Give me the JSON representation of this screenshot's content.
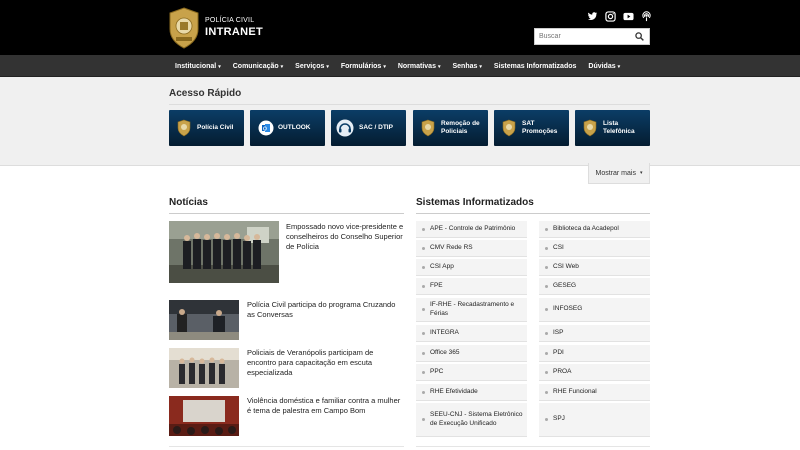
{
  "header": {
    "brand_small": "POLÍCIA CIVIL",
    "brand_big": "INTRANET",
    "search_placeholder": "Buscar",
    "social": [
      "twitter-icon",
      "instagram-icon",
      "youtube-icon",
      "podcast-icon"
    ]
  },
  "nav": {
    "items": [
      {
        "label": "Institucional",
        "dropdown": true
      },
      {
        "label": "Comunicação",
        "dropdown": true
      },
      {
        "label": "Serviços",
        "dropdown": true
      },
      {
        "label": "Formulários",
        "dropdown": true
      },
      {
        "label": "Normativas",
        "dropdown": true
      },
      {
        "label": "Senhas",
        "dropdown": true
      },
      {
        "label": "Sistemas Informatizados",
        "dropdown": false
      },
      {
        "label": "Dúvidas",
        "dropdown": true
      }
    ]
  },
  "quick_access": {
    "title": "Acesso Rápido",
    "buttons": [
      {
        "label": "Polícia Civil",
        "icon": "badge-icon"
      },
      {
        "label": "OUTLOOK",
        "icon": "outlook-icon"
      },
      {
        "label": "SAC / DTIP",
        "icon": "headset-icon"
      },
      {
        "label": "Remoção de Policiais",
        "icon": "badge-icon"
      },
      {
        "label": "SAT Promoções",
        "icon": "badge-icon"
      },
      {
        "label": "Lista Telefônica",
        "icon": "badge-icon"
      }
    ],
    "more_label": "Mostrar mais"
  },
  "news": {
    "title": "Notícias",
    "items": [
      {
        "text": "Empossado novo vice-presidente e conselheiros do Conselho Superior de Polícia"
      },
      {
        "text": "Polícia Civil participa do programa Cruzando as Conversas"
      },
      {
        "text": "Policiais de Veranópolis participam de encontro para capacitação em escuta especializada"
      },
      {
        "text": "Violência doméstica e familiar contra a mulher é tema de palestra em Campo Bom"
      }
    ]
  },
  "systems": {
    "title": "Sistemas Informatizados",
    "left": [
      "APE - Controle de Patrimônio",
      "CMV Rede RS",
      "CSI App",
      "FPE",
      "IF-RHE - Recadastramento e Férias",
      "INTEGRA",
      "Office 365",
      "PPC",
      "RHE Efetividade",
      "SEEU-CNJ - Sistema Eletrônico de Execução Unificado"
    ],
    "right": [
      "Biblioteca da Acadepol",
      "CSI",
      "CSI Web",
      "GESEG",
      "INFOSEG",
      "ISP",
      "PDI",
      "PROA",
      "RHE Funcional",
      "SPJ"
    ]
  },
  "colors": {
    "header_bg": "#000000",
    "nav_bg": "#333333",
    "button_blue": "#0b3d66",
    "badge_gold": "#c8a24a"
  }
}
